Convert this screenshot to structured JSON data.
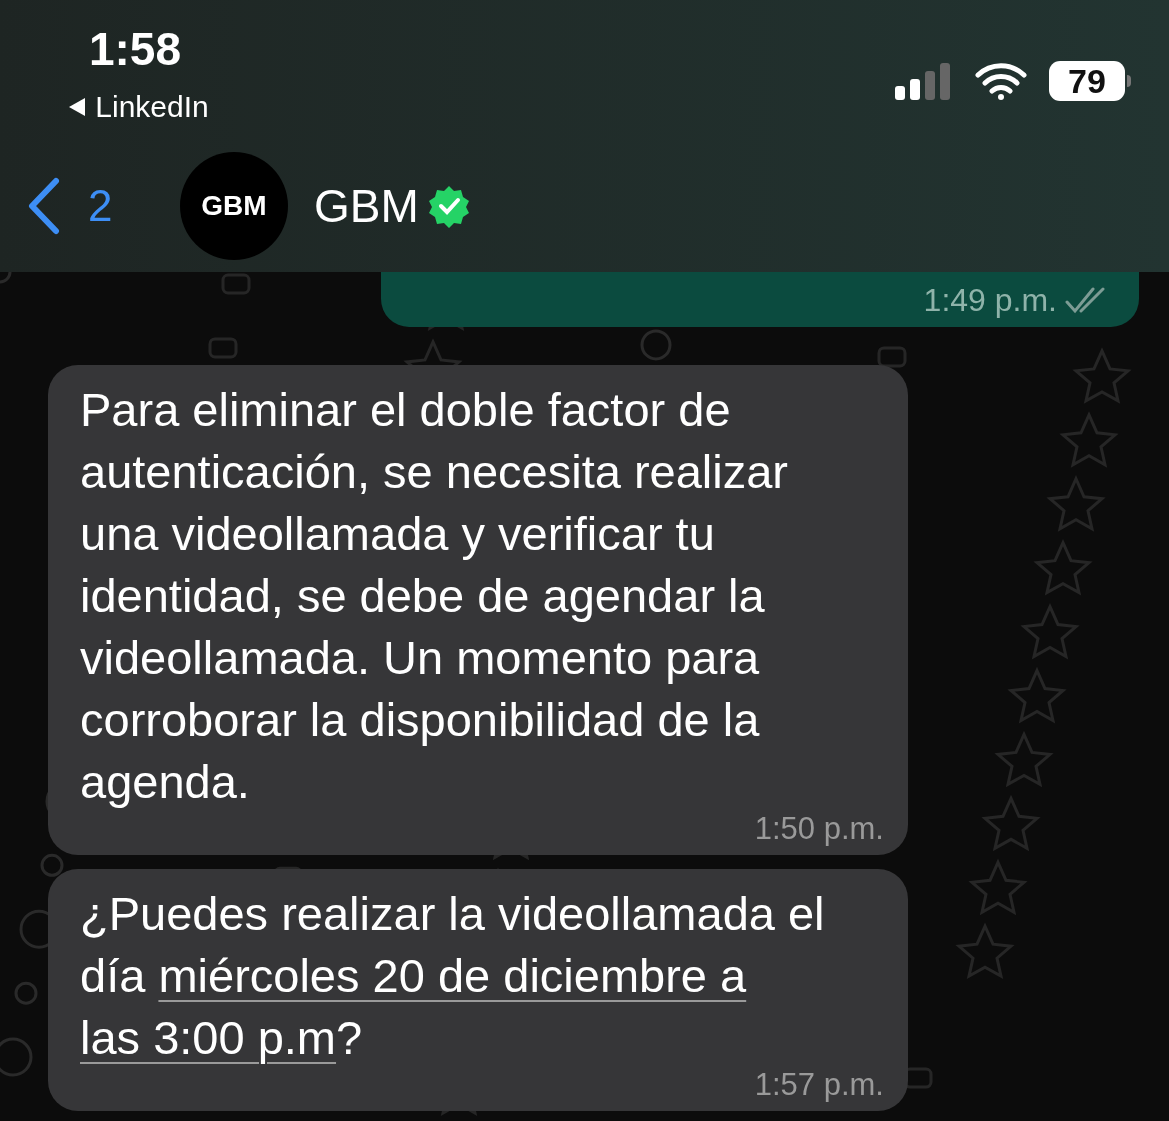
{
  "status_bar": {
    "time": "1:58",
    "back_app": "LinkedIn",
    "battery": "79"
  },
  "header": {
    "back_count": "2",
    "avatar_text": "GBM",
    "title": "GBM",
    "verified": true
  },
  "messages": [
    {
      "kind": "outgoing",
      "time": "1:49 p.m.",
      "read": false
    },
    {
      "kind": "incoming",
      "parts": [
        {
          "kind": "text",
          "text": "Para eliminar el doble factor de autenticación, se necesita realizar una videollamada y verificar tu identidad, se debe de agendar la videollamada. Un momento para corroborar la disponibilidad de la agenda."
        }
      ],
      "time": "1:50 p.m."
    },
    {
      "kind": "incoming",
      "parts": [
        {
          "kind": "text",
          "text": "¿Puedes realizar la videollamada el día "
        },
        {
          "kind": "link",
          "text": "miércoles 20 de diciembre a "
        },
        {
          "kind": "link",
          "text": "las 3:00 p.m"
        },
        {
          "kind": "text",
          "text": "?"
        }
      ],
      "time": "1:57 p.m."
    }
  ]
}
